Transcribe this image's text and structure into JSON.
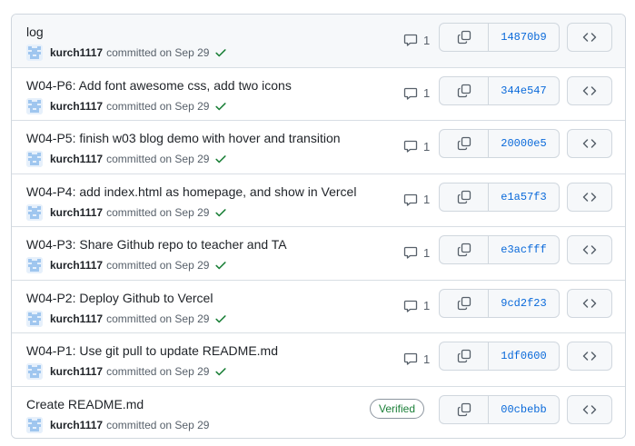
{
  "commits": [
    {
      "title": "log",
      "author": "kurch1117",
      "date_text": "committed on Sep 29",
      "status": "check",
      "comments": "1",
      "sha": "14870b9"
    },
    {
      "title": "W04-P6: Add font awesome css, add two icons",
      "author": "kurch1117",
      "date_text": "committed on Sep 29",
      "status": "check",
      "comments": "1",
      "sha": "344e547"
    },
    {
      "title": "W04-P5: finish w03 blog demo with hover and transition",
      "author": "kurch1117",
      "date_text": "committed on Sep 29",
      "status": "check",
      "comments": "1",
      "sha": "20000e5"
    },
    {
      "title": "W04-P4: add index.html as homepage, and show in Vercel",
      "author": "kurch1117",
      "date_text": "committed on Sep 29",
      "status": "check",
      "comments": "1",
      "sha": "e1a57f3"
    },
    {
      "title": "W04-P3: Share Github repo to teacher and TA",
      "author": "kurch1117",
      "date_text": "committed on Sep 29",
      "status": "check",
      "comments": "1",
      "sha": "e3acfff"
    },
    {
      "title": "W04-P2: Deploy Github to Vercel",
      "author": "kurch1117",
      "date_text": "committed on Sep 29",
      "status": "check",
      "comments": "1",
      "sha": "9cd2f23"
    },
    {
      "title": "W04-P1: Use git pull to update README.md",
      "author": "kurch1117",
      "date_text": "committed on Sep 29",
      "status": "check",
      "comments": "1",
      "sha": "1df0600"
    },
    {
      "title": "Create README.md",
      "author": "kurch1117",
      "date_text": "committed on Sep 29",
      "status": "none",
      "verified_label": "Verified",
      "sha": "00cbebb"
    }
  ],
  "icons": {
    "comment": "comment-icon",
    "copy": "copy-icon",
    "browse": "code-icon",
    "check": "check-icon",
    "avatar": "identicon-avatar"
  },
  "colors": {
    "link": "#0969da",
    "success": "#1a7f37",
    "muted": "#57606a",
    "border": "#d0d7de",
    "avatar": "#9fc6ef"
  }
}
